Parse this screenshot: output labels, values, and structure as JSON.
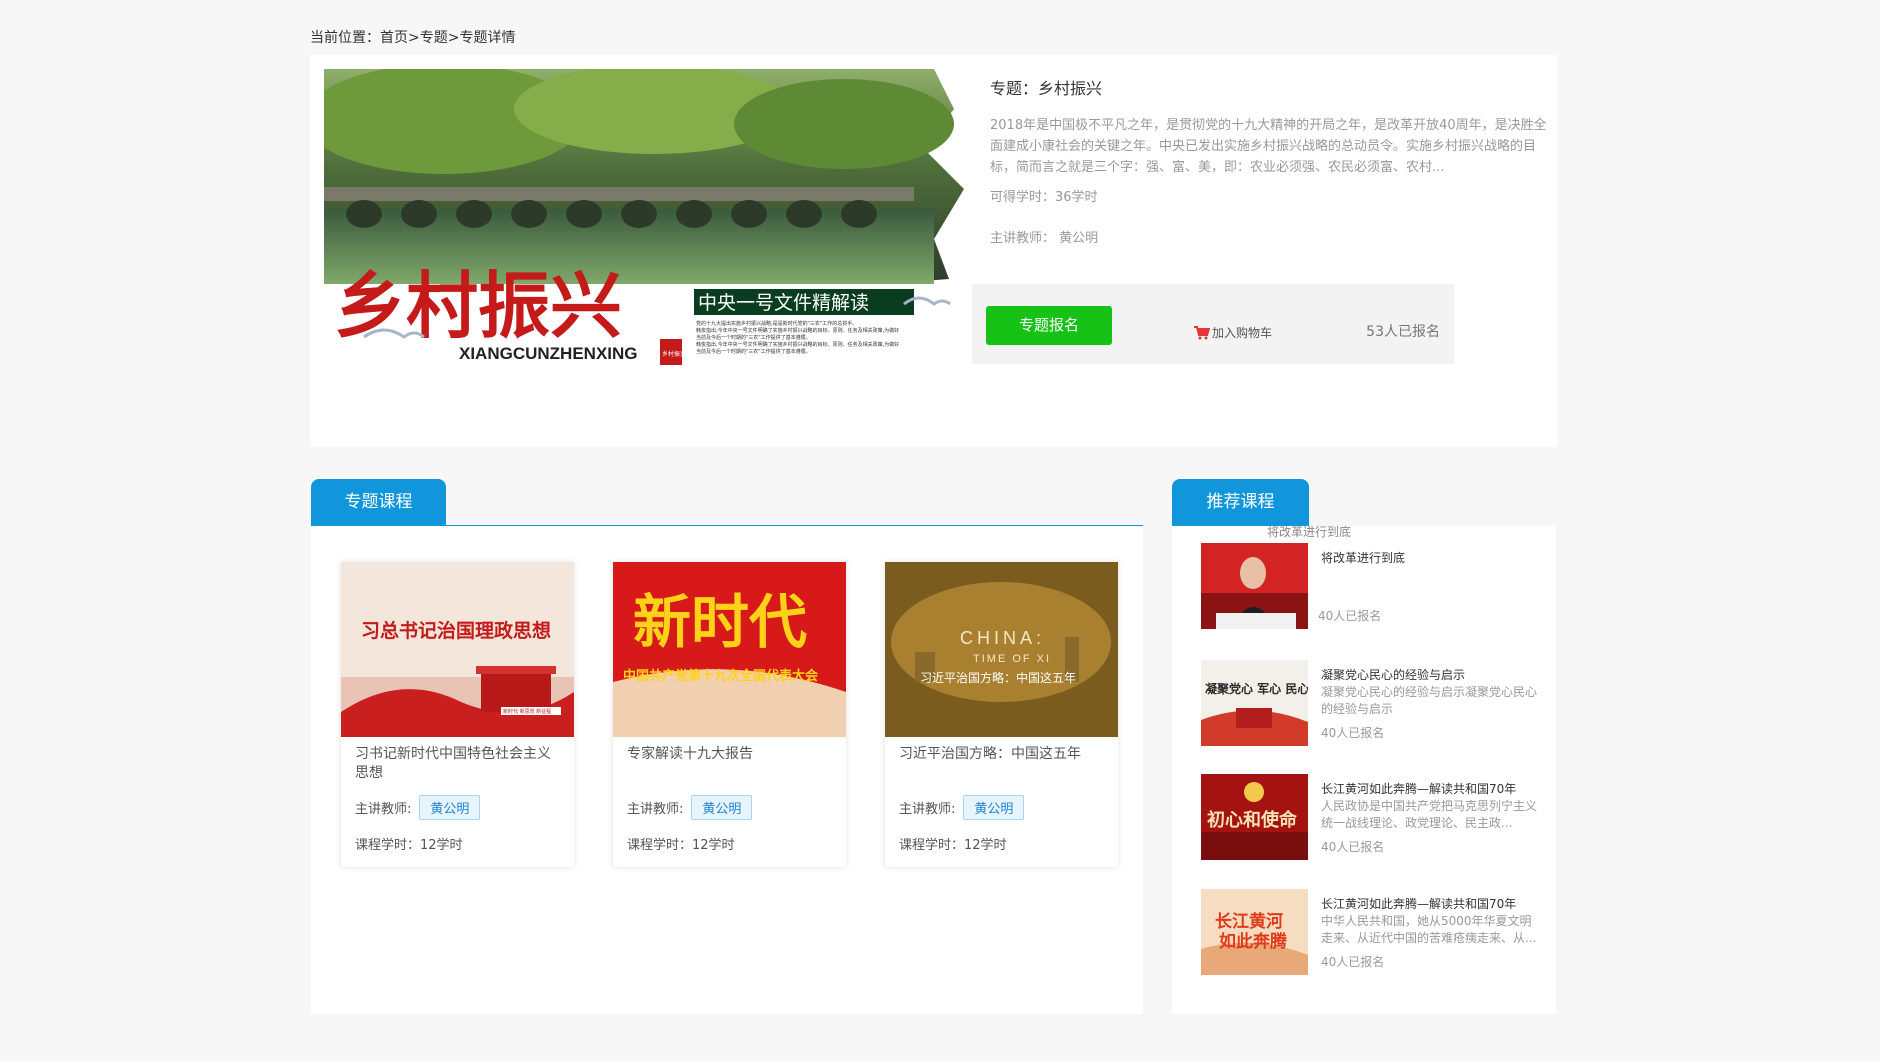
{
  "breadcrumb": {
    "label": "当前位置：",
    "path": "首页>专题>专题详情"
  },
  "topic": {
    "title": "专题：乡村振兴",
    "description": "2018年是中国极不平凡之年，是贯彻党的十九大精神的开局之年，是改革开放40周年，是决胜全面建成小康社会的关键之年。中央已发出实施乡村振兴战略的总动员令。实施乡村振兴战略的目标，简而言之就是三个字：强、富、美，即：农业必须强、农民必须富、农村...",
    "hours": "可得学时：36学时",
    "teacher": "主讲教师：  黄公明",
    "enroll_label": "专题报名",
    "cart_label": "加入购物车",
    "enroll_count": "53人已报名",
    "banner": {
      "main_text": "乡村振兴",
      "pinyin": "XIANGCUNZHENXING",
      "subtitle": "中央一号文件精解读",
      "seal": "乡村振兴",
      "small_text": [
        "党的十九大提出实施乡村振兴战略,是是新时代党的\"三农\"工作的总抓手。",
        "韩俊指出,今年中央一号文件明确了实施乡村振兴战略的目标、原则、任务及相关政策,为做好",
        "当前及今后一个时期的\"三农\"工作提供了基本遵循。",
        "韩俊指出,今年中央一号文件明确了实施乡村振兴战略的目标、原则、任务及相关政策,为做好",
        "当前及今后一个时期的\"三农\"工作提供了基本遵循。"
      ]
    }
  },
  "sections": {
    "topic_courses": "专题课程",
    "recommended": "推荐课程"
  },
  "courses": [
    {
      "name": "习书记新时代中国特色社会主义思想",
      "teacher_label": "主讲教师:",
      "teacher": "黄公明",
      "hours": "课程学时：12学时",
      "thumb_text": "习总书记治国理政思想",
      "thumb_sign": "新时代 新思想 新征程"
    },
    {
      "name": "专家解读十九大报告",
      "teacher_label": "主讲教师:",
      "teacher": "黄公明",
      "hours": "课程学时：12学时",
      "thumb_text": "新时代",
      "thumb_sub": "中国共产党第十九次全国代表大会"
    },
    {
      "name": "习近平治国方略：中国这五年",
      "teacher_label": "主讲教师:",
      "teacher": "黄公明",
      "hours": "课程学时：12学时",
      "thumb_text": "CHINA:",
      "thumb_sub1": "TIME OF XI",
      "thumb_sub2": "习近平治国方略：中国这五年"
    }
  ],
  "recommended_floating": "将改革进行到底",
  "recommended": [
    {
      "title": "将改革进行到底",
      "desc": "",
      "count": "40人已报名"
    },
    {
      "title": "凝聚党心民心的经验与启示",
      "desc": "凝聚党心民心的经验与启示凝聚党心民心的经验与启示",
      "count": "40人已报名",
      "thumb_text": "凝聚党心 军心 民心"
    },
    {
      "title": "长江黄河如此奔腾—解读共和国70年",
      "desc": "人民政协是中国共产党把马克思列宁主义统一战线理论、政党理论、民主政...",
      "count": "40人已报名",
      "thumb_text": "初心和使命"
    },
    {
      "title": "长江黄河如此奔腾—解读共和国70年",
      "desc": "中华人民共和国，她从5000年华夏文明走来、从近代中国的苦难疮痍走来、从...",
      "count": "40人已报名",
      "thumb_text1": "长江黄河",
      "thumb_text2": "如此奔腾"
    }
  ],
  "colors": {
    "accent": "#1296db",
    "enroll_green": "#17c217",
    "cart_red": "#e23838"
  }
}
